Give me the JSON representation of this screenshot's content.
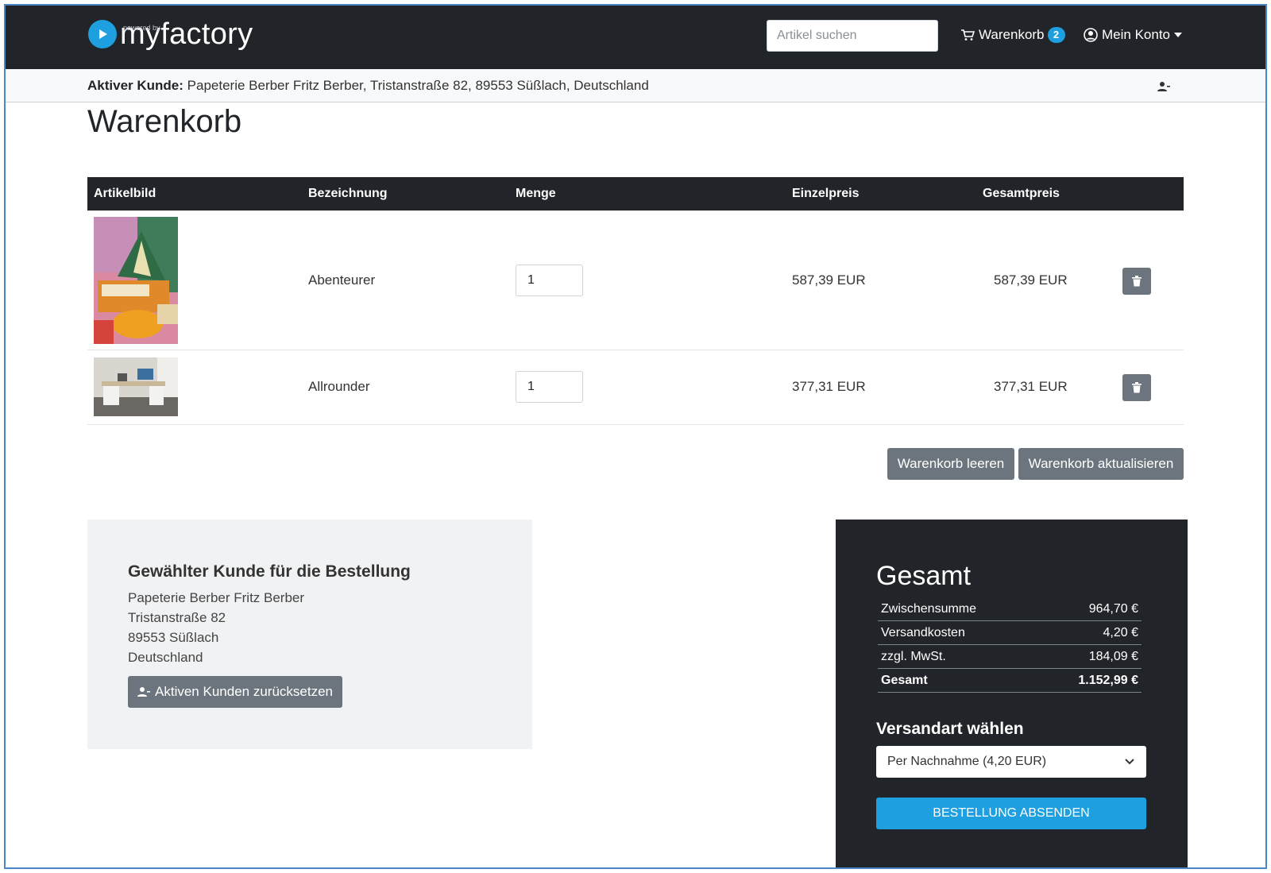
{
  "navbar": {
    "brand": "myfactory",
    "brand_small": "powered by",
    "search_placeholder": "Artikel suchen",
    "cart_label": "Warenkorb",
    "cart_count": "2",
    "account_label": "Mein Konto"
  },
  "active_customer": {
    "label": "Aktiver Kunde:",
    "value": "Papeterie Berber Fritz Berber, Tristanstraße 82, 89553 Süßlach, Deutschland"
  },
  "page_title": "Warenkorb",
  "cart": {
    "headers": [
      "Artikelbild",
      "Bezeichnung",
      "Menge",
      "Einzelpreis",
      "Gesamtpreis"
    ],
    "items": [
      {
        "name": "Abenteurer",
        "qty": "1",
        "unit_price": "587,39 EUR",
        "total_price": "587,39 EUR"
      },
      {
        "name": "Allrounder",
        "qty": "1",
        "unit_price": "377,31 EUR",
        "total_price": "377,31 EUR"
      }
    ],
    "clear_label": "Warenkorb leeren",
    "update_label": "Warenkorb aktualisieren"
  },
  "customer_panel": {
    "heading": "Gewählter Kunde für die Bestellung",
    "lines": [
      "Papeterie Berber Fritz Berber",
      "Tristanstraße 82",
      "89553 Süßlach",
      "Deutschland"
    ],
    "reset_label": "Aktiven Kunden zurücksetzen"
  },
  "totals": {
    "heading": "Gesamt",
    "rows": [
      {
        "label": "Zwischensumme",
        "value": "964,70 €"
      },
      {
        "label": "Versandkosten",
        "value": "4,20 €"
      },
      {
        "label": "zzgl. MwSt.",
        "value": "184,09 €"
      },
      {
        "label": "Gesamt",
        "value": "1.152,99 €"
      }
    ],
    "shipping_heading": "Versandart wählen",
    "shipping_selected": "Per Nachnahme (4,20 EUR)",
    "submit_label": "BESTELLUNG ABSENDEN"
  },
  "colors": {
    "dark": "#212529",
    "accent": "#1e9fe0",
    "button_grey": "#6c757d"
  }
}
